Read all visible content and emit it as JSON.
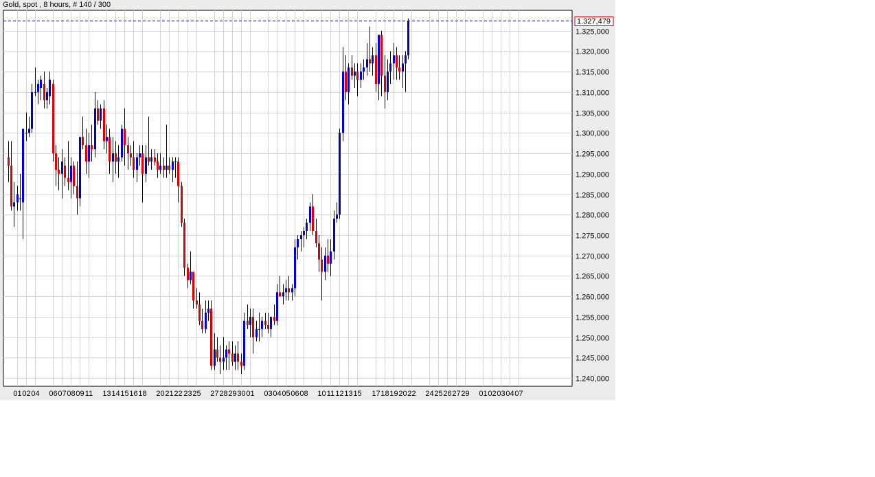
{
  "chart_data": {
    "type": "candlestick",
    "title": "Gold, spot , 8 hours, # 140 / 300",
    "ylim": [
      1238000,
      1330000
    ],
    "ytick_values": [
      1240000,
      1245000,
      1250000,
      1255000,
      1260000,
      1265000,
      1270000,
      1275000,
      1280000,
      1285000,
      1290000,
      1295000,
      1300000,
      1305000,
      1310000,
      1315000,
      1320000,
      1325000
    ],
    "ytick_labels": [
      "1.240,000",
      "1.245,000",
      "1.250,000",
      "1.255,000",
      "1.260,000",
      "1.265,000",
      "1.270,000",
      "1.275,000",
      "1.280,000",
      "1.285,000",
      "1.290,000",
      "1.295,000",
      "1.300,000",
      "1.305,000",
      "1.310,000",
      "1.315,000",
      "1.320,000",
      "1.325,000"
    ],
    "xtick_labels": [
      {
        "i": 3,
        "label": "01"
      },
      {
        "i": 6,
        "label": "02"
      },
      {
        "i": 9,
        "label": "04"
      },
      {
        "i": 15,
        "label": "06"
      },
      {
        "i": 18,
        "label": "07"
      },
      {
        "i": 21,
        "label": "08"
      },
      {
        "i": 24,
        "label": "09"
      },
      {
        "i": 27,
        "label": "11"
      },
      {
        "i": 33,
        "label": "13"
      },
      {
        "i": 36,
        "label": "14"
      },
      {
        "i": 39,
        "label": "15"
      },
      {
        "i": 42,
        "label": "16"
      },
      {
        "i": 45,
        "label": "18"
      },
      {
        "i": 51,
        "label": "20"
      },
      {
        "i": 54,
        "label": "21"
      },
      {
        "i": 57,
        "label": "22"
      },
      {
        "i": 60,
        "label": "23"
      },
      {
        "i": 63,
        "label": "25"
      },
      {
        "i": 69,
        "label": "27"
      },
      {
        "i": 72,
        "label": "28"
      },
      {
        "i": 75,
        "label": "29"
      },
      {
        "i": 78,
        "label": "30"
      },
      {
        "i": 81,
        "label": "01"
      },
      {
        "i": 87,
        "label": "03"
      },
      {
        "i": 90,
        "label": "04"
      },
      {
        "i": 93,
        "label": "05"
      },
      {
        "i": 96,
        "label": "06"
      },
      {
        "i": 99,
        "label": "08"
      },
      {
        "i": 105,
        "label": "10"
      },
      {
        "i": 108,
        "label": "11"
      },
      {
        "i": 111,
        "label": "12"
      },
      {
        "i": 114,
        "label": "13"
      },
      {
        "i": 117,
        "label": "15"
      },
      {
        "i": 123,
        "label": "17"
      },
      {
        "i": 126,
        "label": "18"
      },
      {
        "i": 129,
        "label": "19"
      },
      {
        "i": 132,
        "label": "20"
      },
      {
        "i": 135,
        "label": "22"
      },
      {
        "i": 141,
        "label": "24"
      },
      {
        "i": 144,
        "label": "25"
      },
      {
        "i": 147,
        "label": "26"
      },
      {
        "i": 150,
        "label": "27"
      },
      {
        "i": 153,
        "label": "29"
      },
      {
        "i": 159,
        "label": "01"
      },
      {
        "i": 162,
        "label": "02"
      },
      {
        "i": 165,
        "label": "03"
      },
      {
        "i": 168,
        "label": "04"
      },
      {
        "i": 171,
        "label": "07"
      }
    ],
    "last_price_label": "1.327,479",
    "last_price": 1327479,
    "colors": {
      "up": "#0000cc",
      "down": "#dd0000",
      "wick": "#000000",
      "grid": "#d4d4d4",
      "plot_bg": "#ffffff",
      "panel_bg": "#ececec",
      "last_line": "#000080",
      "last_box": "#dd0000"
    },
    "candles": [
      [
        1294000,
        1298000,
        1288000,
        1292000
      ],
      [
        1292000,
        1298000,
        1281000,
        1282000
      ],
      [
        1282000,
        1288000,
        1277000,
        1283000
      ],
      [
        1283000,
        1287000,
        1281000,
        1285000
      ],
      [
        1284000,
        1290000,
        1281000,
        1284000
      ],
      [
        1283000,
        1290000,
        1274000,
        1301000
      ],
      [
        1300000,
        1305000,
        1298000,
        1300000
      ],
      [
        1300000,
        1304000,
        1299000,
        1301000
      ],
      [
        1301000,
        1312000,
        1300000,
        1310000
      ],
      [
        1310000,
        1316000,
        1309000,
        1310000
      ],
      [
        1310000,
        1313000,
        1307000,
        1312000
      ],
      [
        1311000,
        1314000,
        1308000,
        1313000
      ],
      [
        1312000,
        1315000,
        1306000,
        1308000
      ],
      [
        1308000,
        1311000,
        1306000,
        1310000
      ],
      [
        1309000,
        1315000,
        1307000,
        1313000
      ],
      [
        1312000,
        1313000,
        1293000,
        1295000
      ],
      [
        1295000,
        1297000,
        1287000,
        1291000
      ],
      [
        1291000,
        1294000,
        1286000,
        1290000
      ],
      [
        1290000,
        1296000,
        1284000,
        1293000
      ],
      [
        1292000,
        1294000,
        1287000,
        1289000
      ],
      [
        1289000,
        1298000,
        1286000,
        1288000
      ],
      [
        1288000,
        1294000,
        1284000,
        1292000
      ],
      [
        1292000,
        1293000,
        1285000,
        1287000
      ],
      [
        1287000,
        1293000,
        1280000,
        1284000
      ],
      [
        1284000,
        1297000,
        1282000,
        1299000
      ],
      [
        1299000,
        1304000,
        1296000,
        1297000
      ],
      [
        1297000,
        1301000,
        1290000,
        1293000
      ],
      [
        1293000,
        1300000,
        1289000,
        1297000
      ],
      [
        1297000,
        1302000,
        1293000,
        1296000
      ],
      [
        1296000,
        1310000,
        1294000,
        1306000
      ],
      [
        1306000,
        1308000,
        1302000,
        1303000
      ],
      [
        1303000,
        1307000,
        1301000,
        1306000
      ],
      [
        1306000,
        1308000,
        1296000,
        1298000
      ],
      [
        1298000,
        1302000,
        1295000,
        1299000
      ],
      [
        1299000,
        1301000,
        1290000,
        1293000
      ],
      [
        1293000,
        1299000,
        1288000,
        1295000
      ],
      [
        1295000,
        1298000,
        1290000,
        1293000
      ],
      [
        1293000,
        1297000,
        1289000,
        1294000
      ],
      [
        1294000,
        1302000,
        1293000,
        1301000
      ],
      [
        1301000,
        1306000,
        1292000,
        1297000
      ],
      [
        1297000,
        1299000,
        1291000,
        1295000
      ],
      [
        1295000,
        1297000,
        1292000,
        1294000
      ],
      [
        1294000,
        1298000,
        1289000,
        1291000
      ],
      [
        1291000,
        1295000,
        1288000,
        1294000
      ],
      [
        1294000,
        1297000,
        1292000,
        1295000
      ],
      [
        1295000,
        1297000,
        1283000,
        1290000
      ],
      [
        1290000,
        1297000,
        1288000,
        1294000
      ],
      [
        1294000,
        1304000,
        1292000,
        1293000
      ],
      [
        1293000,
        1296000,
        1291000,
        1294000
      ],
      [
        1294000,
        1296000,
        1292000,
        1293000
      ],
      [
        1293000,
        1295000,
        1289000,
        1291000
      ],
      [
        1291000,
        1295000,
        1290000,
        1292000
      ],
      [
        1292000,
        1294000,
        1289000,
        1291000
      ],
      [
        1291000,
        1302000,
        1289000,
        1292000
      ],
      [
        1292000,
        1294000,
        1290000,
        1291000
      ],
      [
        1291000,
        1294000,
        1288000,
        1293000
      ],
      [
        1293000,
        1294000,
        1289000,
        1293000
      ],
      [
        1293000,
        1294000,
        1283000,
        1287000
      ],
      [
        1287000,
        1288000,
        1277000,
        1278000
      ],
      [
        1278000,
        1279000,
        1265000,
        1267000
      ],
      [
        1267000,
        1268000,
        1262000,
        1264000
      ],
      [
        1264000,
        1271000,
        1263000,
        1266000
      ],
      [
        1266000,
        1266000,
        1257000,
        1259000
      ],
      [
        1259000,
        1262000,
        1257000,
        1258000
      ],
      [
        1258000,
        1261000,
        1253000,
        1254000
      ],
      [
        1254000,
        1257000,
        1251000,
        1252000
      ],
      [
        1252000,
        1259000,
        1251000,
        1256000
      ],
      [
        1256000,
        1259000,
        1254000,
        1257000
      ],
      [
        1257000,
        1259000,
        1242000,
        1243000
      ],
      [
        1243000,
        1251000,
        1242000,
        1247000
      ],
      [
        1247000,
        1250000,
        1244000,
        1245000
      ],
      [
        1245000,
        1248000,
        1241000,
        1244000
      ],
      [
        1244000,
        1250000,
        1242000,
        1245000
      ],
      [
        1245000,
        1248000,
        1242000,
        1247000
      ],
      [
        1247000,
        1249000,
        1242000,
        1246000
      ],
      [
        1246000,
        1249000,
        1243000,
        1244000
      ],
      [
        1244000,
        1248000,
        1242000,
        1246000
      ],
      [
        1246000,
        1249000,
        1242000,
        1244000
      ],
      [
        1244000,
        1246000,
        1241000,
        1243000
      ],
      [
        1243000,
        1256000,
        1242000,
        1254000
      ],
      [
        1254000,
        1258000,
        1252000,
        1253000
      ],
      [
        1253000,
        1257000,
        1250000,
        1255000
      ],
      [
        1255000,
        1257000,
        1246000,
        1250000
      ],
      [
        1250000,
        1254000,
        1249000,
        1252000
      ],
      [
        1252000,
        1256000,
        1249000,
        1252000
      ],
      [
        1252000,
        1255000,
        1250000,
        1254000
      ],
      [
        1254000,
        1256000,
        1252000,
        1253000
      ],
      [
        1253000,
        1256000,
        1251000,
        1252000
      ],
      [
        1252000,
        1255000,
        1250000,
        1255000
      ],
      [
        1255000,
        1258000,
        1253000,
        1254000
      ],
      [
        1254000,
        1263000,
        1253000,
        1261000
      ],
      [
        1261000,
        1265000,
        1260000,
        1260000
      ],
      [
        1260000,
        1263000,
        1258000,
        1261000
      ],
      [
        1261000,
        1264000,
        1259000,
        1262000
      ],
      [
        1262000,
        1265000,
        1259000,
        1261000
      ],
      [
        1261000,
        1263000,
        1259000,
        1262000
      ],
      [
        1262000,
        1274000,
        1260000,
        1272000
      ],
      [
        1272000,
        1275000,
        1269000,
        1274000
      ],
      [
        1274000,
        1276000,
        1271000,
        1275000
      ],
      [
        1275000,
        1277000,
        1272000,
        1276000
      ],
      [
        1276000,
        1279000,
        1274000,
        1278000
      ],
      [
        1278000,
        1283000,
        1276000,
        1282000
      ],
      [
        1282000,
        1285000,
        1275000,
        1276000
      ],
      [
        1276000,
        1279000,
        1272000,
        1273000
      ],
      [
        1273000,
        1275000,
        1266000,
        1269000
      ],
      [
        1269000,
        1272000,
        1259000,
        1266000
      ],
      [
        1266000,
        1272000,
        1264000,
        1270000
      ],
      [
        1270000,
        1274000,
        1266000,
        1268000
      ],
      [
        1268000,
        1274000,
        1265000,
        1271000
      ],
      [
        1271000,
        1281000,
        1269000,
        1279000
      ],
      [
        1279000,
        1283000,
        1278000,
        1280000
      ],
      [
        1280000,
        1301000,
        1279000,
        1300000
      ],
      [
        1300000,
        1321000,
        1298000,
        1315000
      ],
      [
        1315000,
        1319000,
        1308000,
        1310000
      ],
      [
        1310000,
        1317000,
        1307000,
        1316000
      ],
      [
        1316000,
        1319000,
        1313000,
        1314000
      ],
      [
        1314000,
        1317000,
        1311000,
        1315000
      ],
      [
        1315000,
        1317000,
        1309000,
        1313000
      ],
      [
        1313000,
        1317000,
        1311000,
        1315000
      ],
      [
        1315000,
        1318000,
        1313000,
        1316000
      ],
      [
        1316000,
        1322000,
        1314000,
        1318000
      ],
      [
        1318000,
        1326000,
        1315000,
        1317000
      ],
      [
        1317000,
        1321000,
        1314000,
        1319000
      ],
      [
        1319000,
        1322000,
        1310000,
        1312000
      ],
      [
        1312000,
        1318000,
        1308000,
        1324000
      ],
      [
        1324000,
        1325000,
        1309000,
        1314000
      ],
      [
        1314000,
        1319000,
        1306000,
        1310000
      ],
      [
        1310000,
        1318000,
        1308000,
        1315000
      ],
      [
        1315000,
        1320000,
        1312000,
        1317000
      ],
      [
        1317000,
        1322000,
        1313000,
        1319000
      ],
      [
        1319000,
        1321000,
        1313000,
        1316000
      ],
      [
        1316000,
        1319000,
        1313000,
        1315000
      ],
      [
        1315000,
        1319000,
        1311000,
        1317000
      ],
      [
        1317000,
        1320000,
        1310000,
        1319000
      ],
      [
        1319000,
        1328000,
        1318000,
        1327479
      ]
    ]
  }
}
